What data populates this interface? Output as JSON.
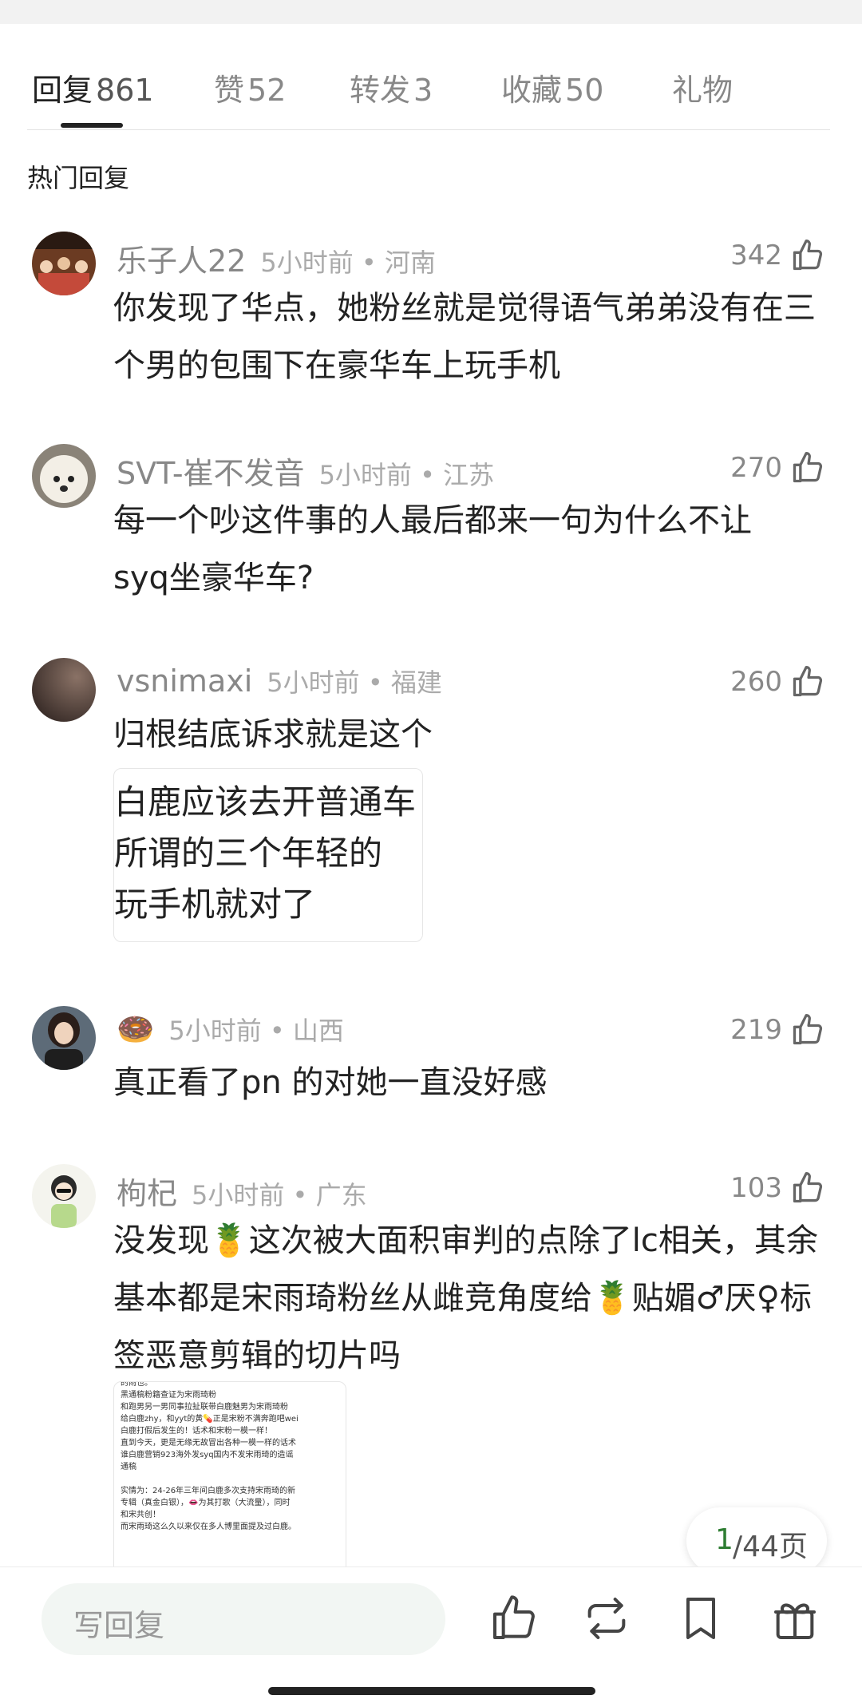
{
  "tabs": [
    {
      "label": "回复",
      "count": "861"
    },
    {
      "label": "赞",
      "count": "52"
    },
    {
      "label": "转发",
      "count": "3"
    },
    {
      "label": "收藏",
      "count": "50"
    },
    {
      "label": "礼物",
      "count": ""
    }
  ],
  "section_title": "热门回复",
  "comments": [
    {
      "user": "乐子人22",
      "time": "5小时前 • 河南",
      "likes": "342",
      "text": "你发现了华点，她粉丝就是觉得语气弟弟没有在三个男的包围下在豪华车上玩手机"
    },
    {
      "user": "SVT-崔不发音",
      "time": "5小时前 • 江苏",
      "likes": "270",
      "text": "每一个吵这件事的人最后都来一句为什么不让syq坐豪华车?"
    },
    {
      "user": "vsnimaxi",
      "time": "5小时前 • 福建",
      "likes": "260",
      "text": "归根结底诉求就是这个",
      "image_lines": [
        "白鹿应该去开普通车",
        "所谓的三个年轻的",
        "玩手机就对了"
      ]
    },
    {
      "user": "🍩",
      "time": "5小时前 • 山西",
      "likes": "219",
      "text": "真正看了pn 的对她一直没好感"
    },
    {
      "user": "枸杞",
      "time": "5小时前 • 广东",
      "likes": "103",
      "text": "没发现🍍这次被大面积审判的点除了lc相关，其余基本都是宋雨琦粉丝从雌竞角度给🍍贴媚♂厌♀标签恶意剪辑的切片吗",
      "image_lines": [
        "的雨也。",
        "黑通稿粉籍查证为宋雨琦粉",
        "和跑男另一男同事拉扯联带白鹿魅男为宋雨琦粉",
        "给白鹿zhy，和yyt的黄💊正是宋粉不满奔跑吧wei",
        "白鹿打假后发生的！话术和宋粉一模一样！",
        "直到今天，更是无缘无故冒出各种一模一样的话术",
        "谁白鹿营销923海外发syq国内不发宋雨琦的造谣",
        "通稿",
        "",
        "实情为：24-26年三年间白鹿多次支持宋雨琦的新",
        "专辑（真金白银），👄为其打歌（大流量），同时",
        "和宋共创！",
        "而宋雨琦这么久以来仅在多人博里面提及过白鹿。"
      ]
    }
  ],
  "pagination": {
    "current": "1",
    "total_label": "/44页"
  },
  "reply_placeholder": "写回复",
  "colors": {
    "accent_green": "#2e7d32",
    "muted_text": "#888888"
  },
  "bottom_icons": [
    "like-icon",
    "repost-icon",
    "bookmark-icon",
    "gift-icon"
  ]
}
